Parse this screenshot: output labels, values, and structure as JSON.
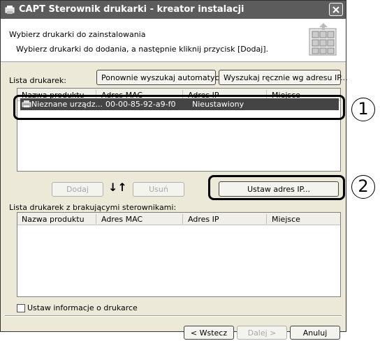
{
  "window": {
    "title": "CAPT Sterownik drukarki - kreator instalacji"
  },
  "header": {
    "title": "Wybierz drukarki do zainstalowania",
    "subtitle": "Wybierz drukarki do dodania, a następnie kliknij przycisk [Dodaj]."
  },
  "printer_list": {
    "label": "Lista drukarek:",
    "rescan_button": "Ponownie wyszukaj automatycznie",
    "manual_search_button": "Wyszukaj ręcznie wg adresu IP...",
    "columns": [
      "Nazwa produktu",
      "Adres MAC",
      "Adres IP",
      "Miejsce"
    ],
    "rows": [
      {
        "name": "Nieznane urządz...",
        "mac": "00-00-85-92-a9-f0",
        "ip": "Nieustawiony",
        "location": ""
      }
    ]
  },
  "controls": {
    "add_button": "Dodaj",
    "remove_button": "Usuń",
    "arrows": "↓↑",
    "set_ip_button": "Ustaw adres IP..."
  },
  "missing_drivers": {
    "label": "Lista drukarek z brakującymi sterownikami:",
    "columns": [
      "Nazwa produktu",
      "Adres MAC",
      "Adres IP",
      "Miejsce"
    ]
  },
  "options": {
    "set_info_checkbox": "Ustaw informacje o drukarce",
    "set_info_checked": false
  },
  "footer": {
    "back_button": "< Wstecz",
    "next_button": "Dalej >",
    "cancel_button": "Anuluj"
  },
  "callouts": [
    "1",
    "2"
  ],
  "colors": {
    "titlebar": "#5c5c5c",
    "window_bg": "#ece9d8",
    "selection": "#444444"
  },
  "icons": [
    "app-icon",
    "close-icon",
    "printer-icon",
    "printers-graphic-icon"
  ]
}
